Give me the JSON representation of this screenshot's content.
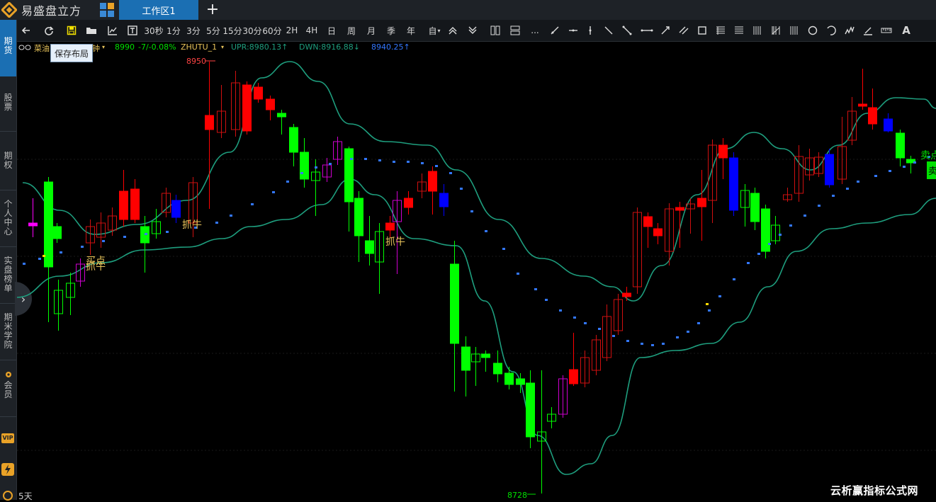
{
  "app": {
    "name": "易盛盘立方",
    "workspace_tab": "工作区1",
    "new_tab": "+"
  },
  "sidebar": {
    "items": [
      "期货",
      "股票",
      "期权",
      "个人中心",
      "实盘榜单",
      "期米学院",
      "会员"
    ],
    "vip_badge": "VIP"
  },
  "toolbar": {
    "tooltip": "保存布局",
    "periods": [
      "30秒",
      "1分",
      "3分",
      "5分",
      "15分",
      "30分",
      "60分",
      "2H",
      "4H",
      "日",
      "周",
      "月",
      "季",
      "年",
      "自"
    ],
    "more": "...",
    "text_tool": "A"
  },
  "info": {
    "symbol": "菜油",
    "period_tail": "钟",
    "price": "8990",
    "change": "-7/-0.08%",
    "indicator": "ZHUTU_1",
    "upr": "UPR:8980.13↑",
    "dwn": "DWN:8916.88↓",
    "mid": "8940.25↑"
  },
  "chart": {
    "high_label": "8950",
    "low_label": "8728",
    "signals": [
      {
        "text": "买点"
      },
      {
        "text": "抓牛"
      },
      {
        "text": "抓牛"
      },
      {
        "text": "抓牛"
      },
      {
        "text": "卖点"
      },
      {
        "text": "卖"
      }
    ],
    "period": "5天"
  },
  "watermark": "云析赢指标公式网",
  "colors": {
    "up": "#ff0000",
    "down": "#00ff00",
    "band": "#1e9e7e",
    "dots": "#3377ff",
    "signal": "#e7c35a",
    "accent": "#1b6fb3"
  }
}
